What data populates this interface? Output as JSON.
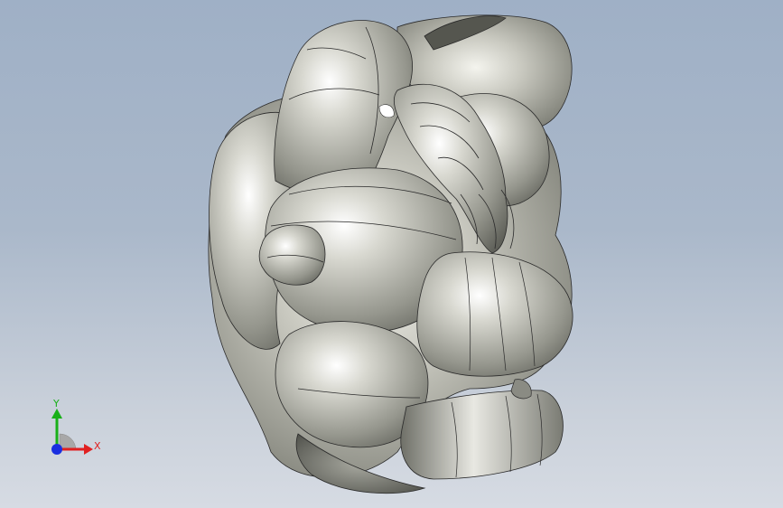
{
  "viewport": {
    "background_top": "#9fb0c6",
    "background_bottom": "#d6dbe3",
    "model_color": "#c6c6bd",
    "edge_color": "#2a2a2a"
  },
  "triad": {
    "x_label": "X",
    "y_label": "Y",
    "x_color": "#e02020",
    "y_color": "#18b018",
    "z_color": "#1a2fe0"
  }
}
